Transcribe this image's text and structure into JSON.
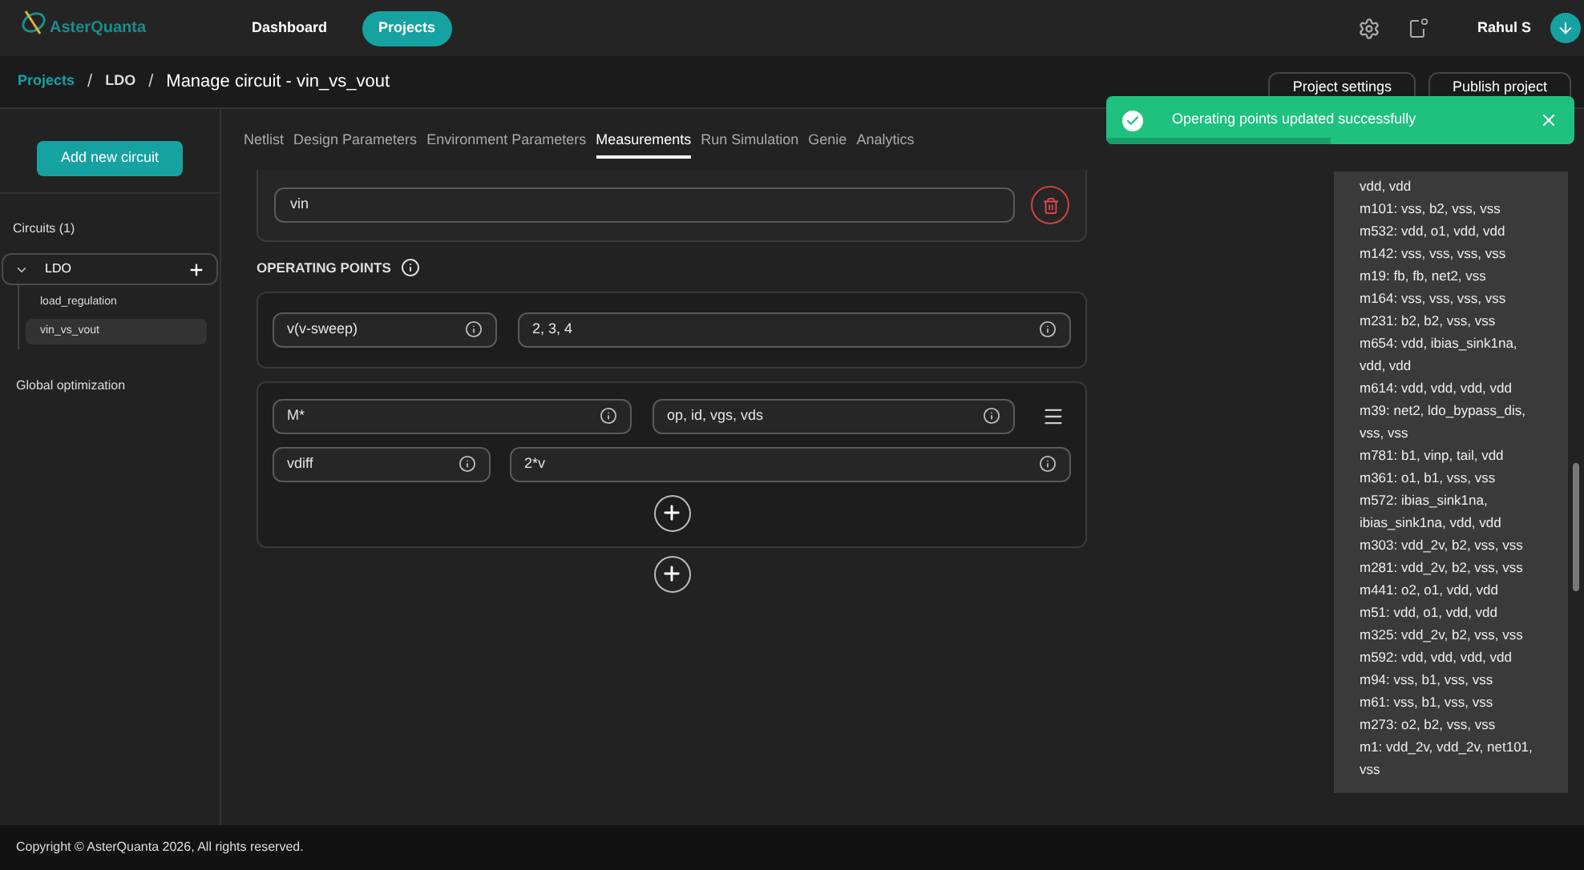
{
  "app": {
    "name": "AsterQuanta"
  },
  "nav": [
    {
      "label": "Dashboard",
      "selected": false
    },
    {
      "label": "Projects",
      "selected": true
    }
  ],
  "user": {
    "name": "Rahul S"
  },
  "breadcrumb": {
    "separator": "/",
    "items": [
      "Projects",
      "LDO"
    ],
    "title": "Manage circuit - vin_vs_vout"
  },
  "header_buttons": [
    "Project settings",
    "Publish project"
  ],
  "toast": {
    "message": "Operating points updated successfully",
    "level": 0.48
  },
  "sidebar": {
    "add_button": "Add new circuit",
    "circuits_heading": "Circuits (1)",
    "group": {
      "label": "LDO",
      "expanded": true,
      "children": [
        {
          "label": "load_regulation",
          "selected": false
        },
        {
          "label": "vin_vs_vout",
          "selected": true
        }
      ]
    },
    "global": "Global optimization"
  },
  "tabs": [
    {
      "label": "Netlist",
      "selected": false
    },
    {
      "label": "Design Parameters",
      "selected": false
    },
    {
      "label": "Environment Parameters",
      "selected": false
    },
    {
      "label": "Measurements",
      "selected": true
    },
    {
      "label": "Run Simulation",
      "selected": false
    },
    {
      "label": "Genie",
      "selected": false
    },
    {
      "label": "Analytics",
      "selected": false
    }
  ],
  "top_field": {
    "value": "vin"
  },
  "operating_points": {
    "heading": "OPERATING POINTS",
    "sweep": {
      "name": "v(v-sweep)",
      "values": "2, 3, 4"
    },
    "group": {
      "rows": [
        {
          "name": "M*",
          "value": "op, id, vgs, vds"
        },
        {
          "name": "vdiff",
          "value": "2*v"
        }
      ]
    }
  },
  "netlist_lines": [
    "vdd, vdd",
    "m101: vss, b2, vss, vss",
    "m532: vdd, o1, vdd, vdd",
    "m142: vss, vss, vss, vss",
    "m19: fb, fb, net2, vss",
    "m164: vss, vss, vss, vss",
    "m231: b2, b2, vss, vss",
    "m654: vdd, ibias_sink1na, vdd, vdd",
    "m614: vdd, vdd, vdd, vdd",
    "m39: net2, ldo_bypass_dis, vss, vss",
    "m781: b1, vinp, tail, vdd",
    "m361: o1, b1, vss, vss",
    "m572: ibias_sink1na, ibias_sink1na, vdd, vdd",
    "m303: vdd_2v, b2, vss, vss",
    "m281: vdd_2v, b2, vss, vss",
    "m441: o2, o1, vdd, vdd",
    "m51: vdd, o1, vdd, vdd",
    "m325: vdd_2v, b2, vss, vss",
    "m592: vdd, vdd, vdd, vdd",
    "m94: vss, b1, vss, vss",
    "m61: vss, b1, vss, vss",
    "m273: o2, b2, vss, vss",
    "m1: vdd_2v, vdd_2v, net101, vss"
  ],
  "footer": "Copyright © AsterQuanta 2026, All rights reserved."
}
